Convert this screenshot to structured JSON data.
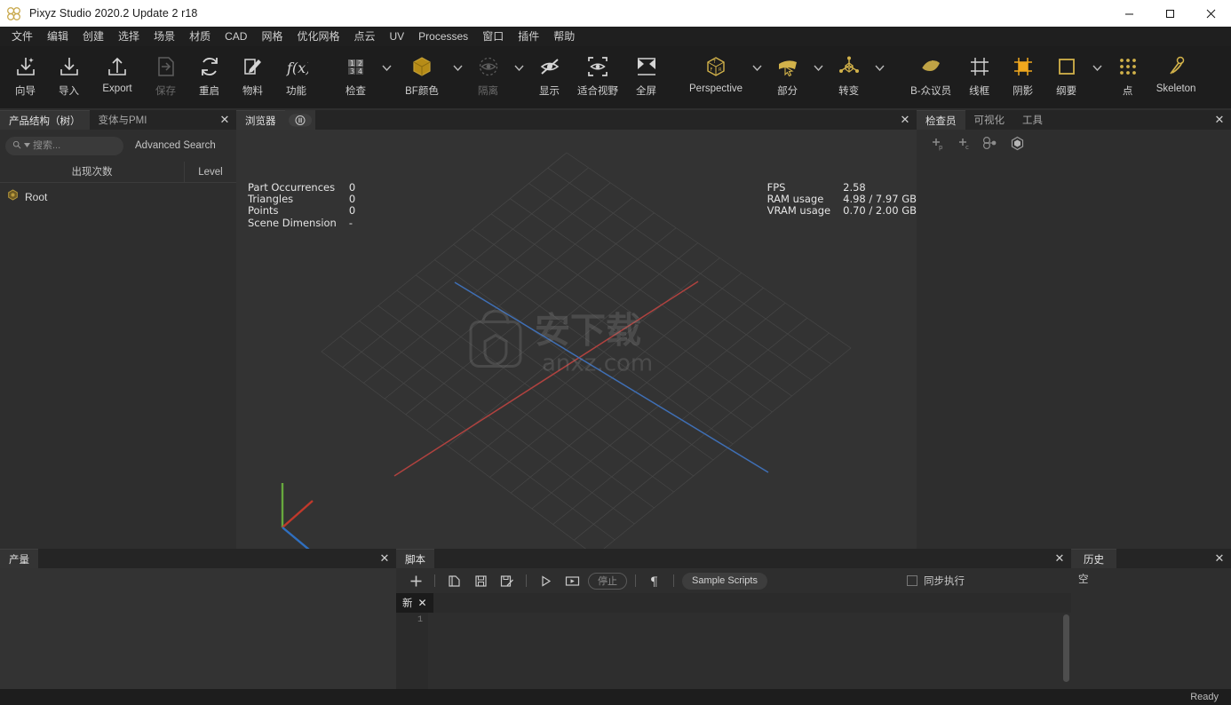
{
  "window": {
    "title": "Pixyz Studio 2020.2 Update 2 r18",
    "app_icon": "pixyz-logo-icon",
    "minimize": "—",
    "maximize": "□",
    "close": "✕"
  },
  "menubar": {
    "items": [
      {
        "label": "文件"
      },
      {
        "label": "编辑"
      },
      {
        "label": "创建"
      },
      {
        "label": "选择"
      },
      {
        "label": "场景"
      },
      {
        "label": "材质"
      },
      {
        "label": "CAD"
      },
      {
        "label": "网格"
      },
      {
        "label": "优化网格"
      },
      {
        "label": "点云"
      },
      {
        "label": "UV"
      },
      {
        "label": "Processes"
      },
      {
        "label": "窗口"
      },
      {
        "label": "插件"
      },
      {
        "label": "帮助"
      }
    ]
  },
  "toolbar": {
    "group1": [
      {
        "label": "向导",
        "icon": "wizard-import-icon",
        "disabled": false
      },
      {
        "label": "导入",
        "icon": "import-icon",
        "disabled": false
      },
      {
        "label": "Export",
        "icon": "export-icon",
        "disabled": false
      },
      {
        "label": "保存",
        "icon": "save-file-icon",
        "disabled": true
      },
      {
        "label": "重启",
        "icon": "restart-icon",
        "disabled": false
      },
      {
        "label": "物料",
        "icon": "material-pencil-icon",
        "disabled": false
      },
      {
        "label": "功能",
        "icon": "function-fx-icon",
        "disabled": false
      }
    ],
    "group2": [
      {
        "label": "检查",
        "icon": "inspect-grid-icon",
        "caret": true,
        "disabled": false
      },
      {
        "label": "BF颜色",
        "icon": "bf-color-cube-icon",
        "caret": true,
        "disabled": false
      },
      {
        "label": "隔离",
        "icon": "isolate-eye-icon",
        "caret": true,
        "disabled": true
      },
      {
        "label": "显示",
        "icon": "hide-eye-slash-icon",
        "caret": false,
        "disabled": false
      },
      {
        "label": "适合视野",
        "icon": "fit-view-icon",
        "caret": false,
        "disabled": false
      },
      {
        "label": "全屏",
        "icon": "fullscreen-icon",
        "caret": false,
        "disabled": false
      }
    ],
    "group3": [
      {
        "label": "Perspective",
        "icon": "perspective-cube-icon",
        "caret": true,
        "disabled": false
      },
      {
        "label": "部分",
        "icon": "selection-part-icon",
        "caret": true,
        "disabled": false
      },
      {
        "label": "转变",
        "icon": "transform-gizmo-icon",
        "caret": true,
        "disabled": false
      }
    ],
    "group4": [
      {
        "label": "B-众议员",
        "icon": "shading-b-icon",
        "caret": false,
        "disabled": false
      },
      {
        "label": "线框",
        "icon": "wireframe-icon",
        "caret": false,
        "disabled": false
      },
      {
        "label": "阴影",
        "icon": "shadow-icon",
        "caret": false,
        "disabled": false
      },
      {
        "label": "纲要",
        "icon": "outline-icon",
        "caret": true,
        "disabled": false
      },
      {
        "label": "点",
        "icon": "points-icon",
        "caret": false,
        "disabled": false
      },
      {
        "label": "Skeleton",
        "icon": "skeleton-icon",
        "caret": false,
        "disabled": false
      }
    ]
  },
  "left_panel": {
    "tabs": [
      {
        "label": "产品结构（树）",
        "active": true
      },
      {
        "label": "变体与PMI",
        "active": false
      }
    ],
    "close": "✕",
    "search": {
      "value": "",
      "placeholder": "搜索...",
      "icon": "search-icon",
      "caret": "caret-down-icon"
    },
    "advanced_search": "Advanced Search",
    "columns": {
      "occurrences": "出现次数",
      "level": "Level"
    },
    "tree": [
      {
        "label": "Root",
        "icon": "node-hex-icon"
      }
    ]
  },
  "center_panel": {
    "tabs": [
      {
        "label": "浏览器",
        "active": true
      }
    ],
    "pause_button": "pause-icon",
    "close": "✕",
    "stats_left": [
      {
        "key": "Part Occurrences",
        "value": "0"
      },
      {
        "key": "Triangles",
        "value": "0"
      },
      {
        "key": "Points",
        "value": "0"
      },
      {
        "key": "Scene Dimension",
        "value": "-"
      }
    ],
    "stats_right": [
      {
        "key": "FPS",
        "value": "2.58"
      },
      {
        "key": "RAM usage",
        "value": "4.98 / 7.97 GB"
      },
      {
        "key": "VRAM usage",
        "value": "0.70 / 2.00 GB"
      }
    ],
    "watermark": "anxz.com",
    "axis_colors": {
      "x": "#b44a4a",
      "y": "#6da34a",
      "z": "#3f7fc4"
    }
  },
  "right_panel": {
    "tabs": [
      {
        "label": "检查员",
        "active": true
      },
      {
        "label": "可视化",
        "active": false
      },
      {
        "label": "工具",
        "active": false
      }
    ],
    "close": "✕",
    "tools": [
      {
        "icon": "add-property-icon"
      },
      {
        "icon": "add-component-icon"
      },
      {
        "icon": "node-link-icon"
      },
      {
        "icon": "hex-solid-icon"
      }
    ]
  },
  "bottom_left": {
    "tabs": [
      {
        "label": "产量",
        "active": true
      }
    ],
    "close": "✕"
  },
  "script_panel": {
    "tabs": [
      {
        "label": "脚本",
        "active": true
      }
    ],
    "close": "✕",
    "toolbar": [
      {
        "icon": "plus-icon",
        "label": "",
        "type": "icon",
        "disabled": false
      },
      {
        "icon": "open-file-icon",
        "label": "",
        "type": "icon",
        "disabled": false
      },
      {
        "icon": "save-icon",
        "label": "",
        "type": "icon",
        "disabled": false
      },
      {
        "icon": "save-as-icon",
        "label": "",
        "type": "icon",
        "disabled": false
      },
      {
        "icon": "run-icon",
        "label": "",
        "type": "icon",
        "disabled": false
      },
      {
        "icon": "run-selection-icon",
        "label": "",
        "type": "icon",
        "disabled": false
      }
    ],
    "stop_label": "停止",
    "paragraph_icon": "pilcrow-icon",
    "sample_scripts": "Sample Scripts",
    "sync_label": "同步执行",
    "sync_checked": false,
    "editor_tab": {
      "label": "新",
      "close": "✕"
    },
    "line_numbers": [
      "1"
    ],
    "code": ""
  },
  "history_panel": {
    "tabs": [
      {
        "label": "历史",
        "active": true
      }
    ],
    "close": "✕",
    "empty_text": "空"
  },
  "statusbar": {
    "text": "Ready"
  }
}
